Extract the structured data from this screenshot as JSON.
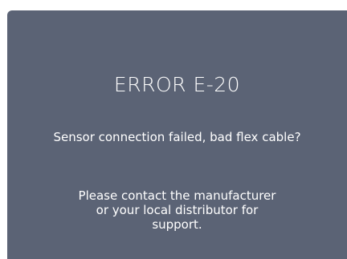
{
  "dialog": {
    "title": "ERROR E-20",
    "message": "Sensor connection failed, bad flex cable?",
    "support_lines": [
      "Please contact the manufacturer",
      "or your local distributor for",
      "support."
    ]
  },
  "colors": {
    "panel_background": "#5b6375",
    "text": "#ffffff",
    "page_background": "#ffffff"
  }
}
